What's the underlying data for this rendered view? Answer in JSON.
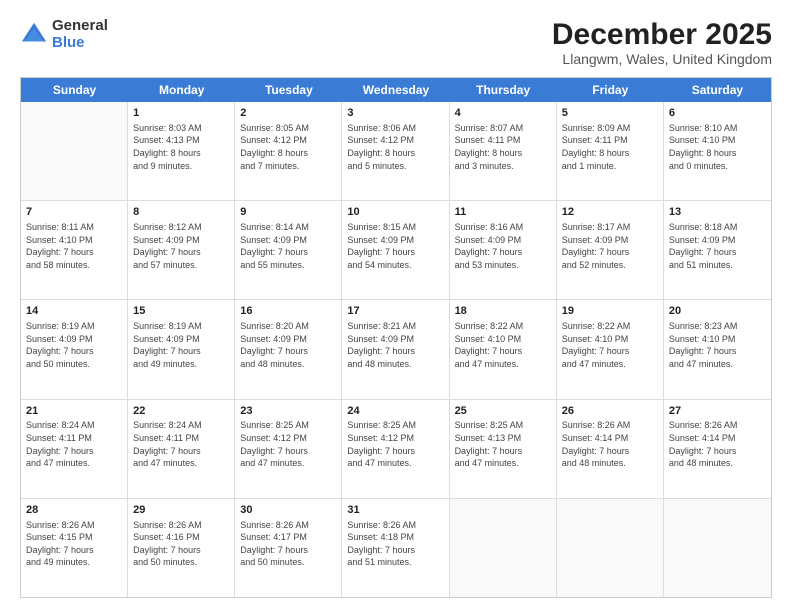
{
  "logo": {
    "general": "General",
    "blue": "Blue"
  },
  "header": {
    "month": "December 2025",
    "location": "Llangwm, Wales, United Kingdom"
  },
  "days": [
    "Sunday",
    "Monday",
    "Tuesday",
    "Wednesday",
    "Thursday",
    "Friday",
    "Saturday"
  ],
  "rows": [
    [
      {
        "day": "",
        "info": ""
      },
      {
        "day": "1",
        "info": "Sunrise: 8:03 AM\nSunset: 4:13 PM\nDaylight: 8 hours\nand 9 minutes."
      },
      {
        "day": "2",
        "info": "Sunrise: 8:05 AM\nSunset: 4:12 PM\nDaylight: 8 hours\nand 7 minutes."
      },
      {
        "day": "3",
        "info": "Sunrise: 8:06 AM\nSunset: 4:12 PM\nDaylight: 8 hours\nand 5 minutes."
      },
      {
        "day": "4",
        "info": "Sunrise: 8:07 AM\nSunset: 4:11 PM\nDaylight: 8 hours\nand 3 minutes."
      },
      {
        "day": "5",
        "info": "Sunrise: 8:09 AM\nSunset: 4:11 PM\nDaylight: 8 hours\nand 1 minute."
      },
      {
        "day": "6",
        "info": "Sunrise: 8:10 AM\nSunset: 4:10 PM\nDaylight: 8 hours\nand 0 minutes."
      }
    ],
    [
      {
        "day": "7",
        "info": "Sunrise: 8:11 AM\nSunset: 4:10 PM\nDaylight: 7 hours\nand 58 minutes."
      },
      {
        "day": "8",
        "info": "Sunrise: 8:12 AM\nSunset: 4:09 PM\nDaylight: 7 hours\nand 57 minutes."
      },
      {
        "day": "9",
        "info": "Sunrise: 8:14 AM\nSunset: 4:09 PM\nDaylight: 7 hours\nand 55 minutes."
      },
      {
        "day": "10",
        "info": "Sunrise: 8:15 AM\nSunset: 4:09 PM\nDaylight: 7 hours\nand 54 minutes."
      },
      {
        "day": "11",
        "info": "Sunrise: 8:16 AM\nSunset: 4:09 PM\nDaylight: 7 hours\nand 53 minutes."
      },
      {
        "day": "12",
        "info": "Sunrise: 8:17 AM\nSunset: 4:09 PM\nDaylight: 7 hours\nand 52 minutes."
      },
      {
        "day": "13",
        "info": "Sunrise: 8:18 AM\nSunset: 4:09 PM\nDaylight: 7 hours\nand 51 minutes."
      }
    ],
    [
      {
        "day": "14",
        "info": "Sunrise: 8:19 AM\nSunset: 4:09 PM\nDaylight: 7 hours\nand 50 minutes."
      },
      {
        "day": "15",
        "info": "Sunrise: 8:19 AM\nSunset: 4:09 PM\nDaylight: 7 hours\nand 49 minutes."
      },
      {
        "day": "16",
        "info": "Sunrise: 8:20 AM\nSunset: 4:09 PM\nDaylight: 7 hours\nand 48 minutes."
      },
      {
        "day": "17",
        "info": "Sunrise: 8:21 AM\nSunset: 4:09 PM\nDaylight: 7 hours\nand 48 minutes."
      },
      {
        "day": "18",
        "info": "Sunrise: 8:22 AM\nSunset: 4:10 PM\nDaylight: 7 hours\nand 47 minutes."
      },
      {
        "day": "19",
        "info": "Sunrise: 8:22 AM\nSunset: 4:10 PM\nDaylight: 7 hours\nand 47 minutes."
      },
      {
        "day": "20",
        "info": "Sunrise: 8:23 AM\nSunset: 4:10 PM\nDaylight: 7 hours\nand 47 minutes."
      }
    ],
    [
      {
        "day": "21",
        "info": "Sunrise: 8:24 AM\nSunset: 4:11 PM\nDaylight: 7 hours\nand 47 minutes."
      },
      {
        "day": "22",
        "info": "Sunrise: 8:24 AM\nSunset: 4:11 PM\nDaylight: 7 hours\nand 47 minutes."
      },
      {
        "day": "23",
        "info": "Sunrise: 8:25 AM\nSunset: 4:12 PM\nDaylight: 7 hours\nand 47 minutes."
      },
      {
        "day": "24",
        "info": "Sunrise: 8:25 AM\nSunset: 4:12 PM\nDaylight: 7 hours\nand 47 minutes."
      },
      {
        "day": "25",
        "info": "Sunrise: 8:25 AM\nSunset: 4:13 PM\nDaylight: 7 hours\nand 47 minutes."
      },
      {
        "day": "26",
        "info": "Sunrise: 8:26 AM\nSunset: 4:14 PM\nDaylight: 7 hours\nand 48 minutes."
      },
      {
        "day": "27",
        "info": "Sunrise: 8:26 AM\nSunset: 4:14 PM\nDaylight: 7 hours\nand 48 minutes."
      }
    ],
    [
      {
        "day": "28",
        "info": "Sunrise: 8:26 AM\nSunset: 4:15 PM\nDaylight: 7 hours\nand 49 minutes."
      },
      {
        "day": "29",
        "info": "Sunrise: 8:26 AM\nSunset: 4:16 PM\nDaylight: 7 hours\nand 50 minutes."
      },
      {
        "day": "30",
        "info": "Sunrise: 8:26 AM\nSunset: 4:17 PM\nDaylight: 7 hours\nand 50 minutes."
      },
      {
        "day": "31",
        "info": "Sunrise: 8:26 AM\nSunset: 4:18 PM\nDaylight: 7 hours\nand 51 minutes."
      },
      {
        "day": "",
        "info": ""
      },
      {
        "day": "",
        "info": ""
      },
      {
        "day": "",
        "info": ""
      }
    ]
  ]
}
